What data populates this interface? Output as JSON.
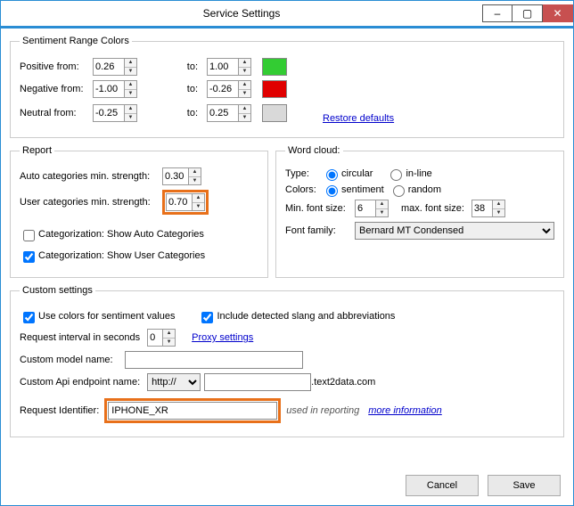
{
  "window": {
    "title": "Service Settings"
  },
  "sentiment": {
    "legend": "Sentiment Range Colors",
    "positive_from_label": "Positive from:",
    "positive_from": "0.26",
    "positive_to": "1.00",
    "positive_color": "#33cc33",
    "negative_from_label": "Negative from:",
    "negative_from": "-1.00",
    "negative_to": "-0.26",
    "negative_color": "#e00000",
    "neutral_from_label": "Neutral from:",
    "neutral_from": "-0.25",
    "neutral_to": "0.25",
    "neutral_color": "#d9d9d9",
    "to_label": "to:",
    "restore": "Restore defaults"
  },
  "report": {
    "legend": "Report",
    "auto_label": "Auto categories min. strength:",
    "auto_value": "0.30",
    "user_label": "User categories min. strength:",
    "user_value": "0.70",
    "show_auto": "Categorization: Show Auto Categories",
    "show_user": "Categorization: Show User Categories"
  },
  "wordcloud": {
    "legend": "Word cloud:",
    "type_label": "Type:",
    "type_circular": "circular",
    "type_inline": "in-line",
    "colors_label": "Colors:",
    "colors_sentiment": "sentiment",
    "colors_random": "random",
    "min_font_label": "Min. font size:",
    "min_font": "6",
    "max_font_label": "max. font size:",
    "max_font": "38",
    "family_label": "Font family:",
    "family": "Bernard MT Condensed"
  },
  "custom": {
    "legend": "Custom settings",
    "use_colors": "Use colors for sentiment values",
    "include_slang": "Include detected slang and abbreviations",
    "interval_label": "Request interval in seconds",
    "interval": "0",
    "proxy": "Proxy settings",
    "model_label": "Custom model name:",
    "model": "",
    "endpoint_label": "Custom Api endpoint name:",
    "protocol": "http://",
    "endpoint": "",
    "endpoint_suffix": ".text2data.com",
    "request_id_label": "Request Identifier:",
    "request_id": "IPHONE_XR",
    "request_note": "used in reporting",
    "more_info": "more information"
  },
  "buttons": {
    "cancel": "Cancel",
    "save": "Save"
  }
}
